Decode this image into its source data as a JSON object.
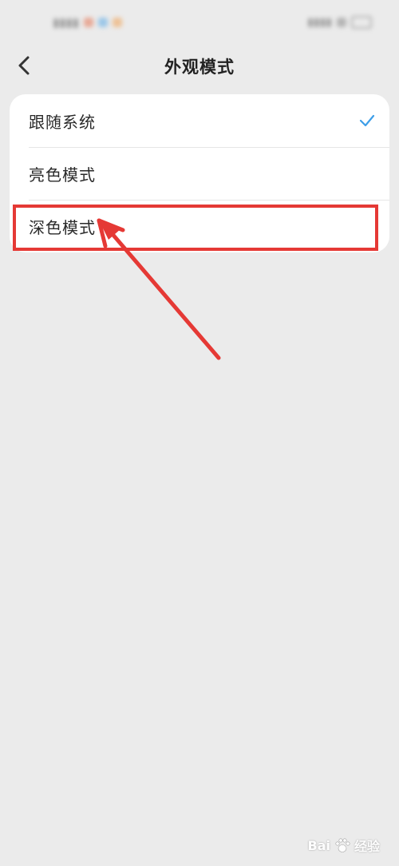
{
  "header": {
    "title": "外观模式"
  },
  "options": [
    {
      "label": "跟随系统",
      "selected": true
    },
    {
      "label": "亮色模式",
      "selected": false
    },
    {
      "label": "深色模式",
      "selected": false
    }
  ],
  "watermark": {
    "brand_left": "Bai",
    "brand_right": "经验"
  },
  "colors": {
    "accent": "#3d9ee8",
    "annotation": "#e53935",
    "background": "#ebebeb",
    "card": "#ffffff"
  }
}
